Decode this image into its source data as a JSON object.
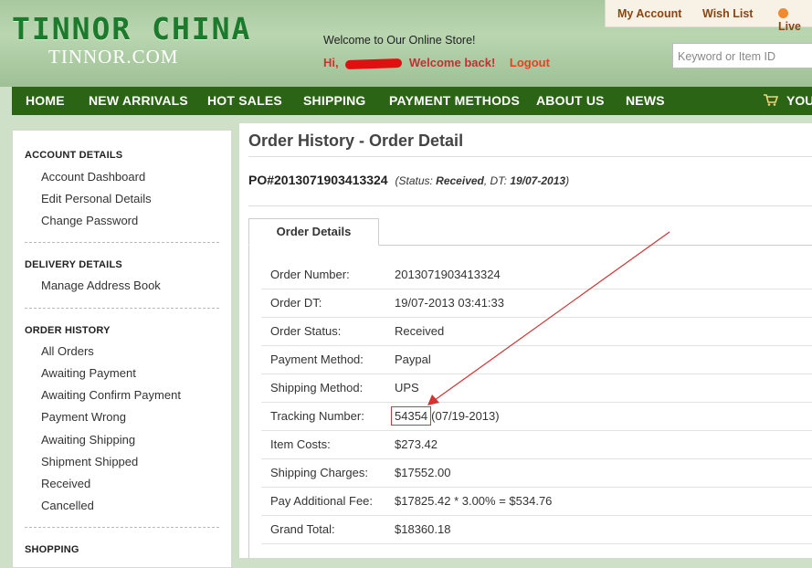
{
  "header": {
    "logo_main": "TINNOR CHINA",
    "logo_sub": "TINNOR.COM",
    "welcome": "Welcome to Our Online Store!",
    "greeting_hi": "Hi,",
    "welcome_back": "Welcome back!",
    "logout": "Logout",
    "search_placeholder": "Keyword or Item ID",
    "top_links": {
      "my_account": "My Account",
      "wish_list": "Wish List",
      "live": "Live"
    }
  },
  "nav": {
    "items": [
      "HOME",
      "NEW ARRIVALS",
      "HOT SALES",
      "SHIPPING",
      "PAYMENT METHODS",
      "ABOUT US",
      "NEWS"
    ],
    "cart_label": "YOU"
  },
  "sidebar": {
    "account_title": "ACCOUNT DETAILS",
    "account_links": [
      "Account Dashboard",
      "Edit Personal Details",
      "Change Password"
    ],
    "delivery_title": "DELIVERY DETAILS",
    "delivery_links": [
      "Manage Address Book"
    ],
    "order_title": "ORDER HISTORY",
    "order_links": [
      "All Orders",
      "Awaiting Payment",
      "Awaiting Confirm Payment",
      "Payment Wrong",
      "Awaiting Shipping",
      "Shipment Shipped",
      "Received",
      "Cancelled"
    ],
    "shopping_title": "SHOPPING"
  },
  "main": {
    "page_title": "Order History - Order Detail",
    "po_number": "PO#2013071903413324",
    "status_prefix": "(Status: ",
    "status_value": "Received",
    "status_dt_label": ", DT: ",
    "status_dt_value": "19/07-2013",
    "status_suffix": ")",
    "tab_label": "Order Details",
    "details": [
      {
        "label": "Order Number:",
        "value": "2013071903413324"
      },
      {
        "label": "Order DT:",
        "value": "19/07-2013 03:41:33"
      },
      {
        "label": "Order Status:",
        "value": "Received"
      },
      {
        "label": "Payment Method:",
        "value": "Paypal"
      },
      {
        "label": "Shipping Method:",
        "value": "UPS"
      },
      {
        "label": "Tracking Number:",
        "value": "54354",
        "extra": "(07/19-2013)"
      },
      {
        "label": "Item Costs:",
        "value": "$273.42"
      },
      {
        "label": "Shipping Charges:",
        "value": "$17552.00"
      },
      {
        "label": "Pay Additional Fee:",
        "value": "$17825.42 * 3.00% = $534.76"
      },
      {
        "label": "Grand Total:",
        "value": "$18360.18"
      }
    ]
  },
  "colors": {
    "nav_bg": "#2c6416",
    "logo_green": "#1b7a2c",
    "annotation_red": "#d33333"
  }
}
